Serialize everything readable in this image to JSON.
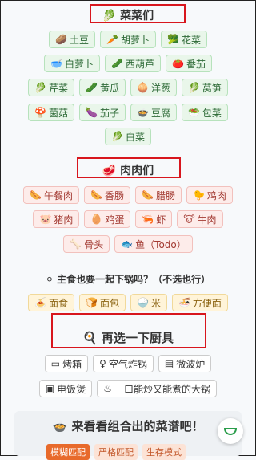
{
  "veg": {
    "title": "🥬 菜菜们",
    "items": [
      {
        "icon": "🥔",
        "label": "土豆"
      },
      {
        "icon": "🥕",
        "label": "胡萝卜"
      },
      {
        "icon": "🥦",
        "label": "花菜"
      },
      {
        "icon": "🥣",
        "label": "白萝卜"
      },
      {
        "icon": "🥒",
        "label": "西葫芦"
      },
      {
        "icon": "🍅",
        "label": "番茄"
      },
      {
        "icon": "🥬",
        "label": "芹菜"
      },
      {
        "icon": "🥒",
        "label": "黄瓜"
      },
      {
        "icon": "🧅",
        "label": "洋葱"
      },
      {
        "icon": "🥬",
        "label": "莴笋"
      },
      {
        "icon": "🍄",
        "label": "菌菇"
      },
      {
        "icon": "🍆",
        "label": "茄子"
      },
      {
        "icon": "🍲",
        "label": "豆腐"
      },
      {
        "icon": "🥗",
        "label": "包菜"
      },
      {
        "icon": "🥬",
        "label": "白菜"
      }
    ]
  },
  "meat": {
    "title": "🥩 肉肉们",
    "items": [
      {
        "icon": "🌭",
        "label": "午餐肉"
      },
      {
        "icon": "🌭",
        "label": "香肠"
      },
      {
        "icon": "🌭",
        "label": "腊肠"
      },
      {
        "icon": "🐤",
        "label": "鸡肉"
      },
      {
        "icon": "🐷",
        "label": "猪肉"
      },
      {
        "icon": "🥚",
        "label": "鸡蛋"
      },
      {
        "icon": "🦐",
        "label": "虾"
      },
      {
        "icon": "🐮",
        "label": "牛肉"
      },
      {
        "icon": "🦴",
        "label": "骨头"
      },
      {
        "icon": "🐟",
        "label": "鱼（Todo）"
      }
    ]
  },
  "staple": {
    "title": "⚪ 主食也要一起下锅吗？（不选也行）",
    "items": [
      {
        "icon": "🍝",
        "label": "面食"
      },
      {
        "icon": "🍞",
        "label": "面包"
      },
      {
        "icon": "🍚",
        "label": "米"
      },
      {
        "icon": "🍜",
        "label": "方便面"
      }
    ]
  },
  "tools": {
    "title": "🍳 再选一下厨具",
    "items": [
      {
        "icon": "▭",
        "label": "烤箱"
      },
      {
        "icon": "♀",
        "label": "空气炸锅"
      },
      {
        "icon": "▤",
        "label": "微波炉"
      },
      {
        "icon": "▣",
        "label": "电饭煲"
      },
      {
        "icon": "♨",
        "label": "一口能炒又能煮的大锅"
      }
    ]
  },
  "result": {
    "title": "🍲 来看看组合出的菜谱吧！",
    "tabs": [
      "模糊匹配",
      "严格匹配",
      "生存模式"
    ]
  },
  "fab_icon": "bowl-icon"
}
